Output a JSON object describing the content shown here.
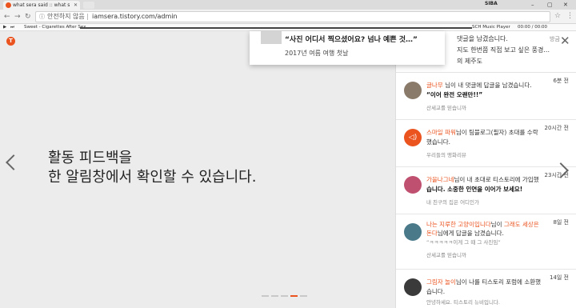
{
  "browser": {
    "tab_title": "what sera said :: what s",
    "user_label": "SIBA",
    "security_label": "안전하지 않음",
    "url": "iamsera.tistory.com/admin"
  },
  "mediabar": {
    "track_title": "Sweet - Cigarettes After Sex",
    "player_name": "SCH Music Player",
    "time": "00:00 / 00:00"
  },
  "page": {
    "logo_letter": "T",
    "headline_line1": "활동 피드백을",
    "headline_line2": "한 알림창에서 확인할 수 있습니다.",
    "pager_count": 5,
    "pager_active_index": 4
  },
  "card": {
    "title": "“사진 어디서 찍으셨어요? 넘나 예쁜 것…”",
    "subtitle": "2017년 여름 여행 첫날"
  },
  "panel": {
    "top_line1": "댓글을 남겼습니다.",
    "top_line2": "지도 한번쯤 직접 보고 싶은 풍경...",
    "top_line3": "의 제주도",
    "top_tag": "방금",
    "notifications": [
      {
        "name": "글나무",
        "text": " 님이 내 댓글에 답글을 남겼습니다.",
        "bold": "“이어 완전 오랜만!!”",
        "sub": "산세교를 믿습니까",
        "time": "6분 전"
      },
      {
        "name": "스마일 파워",
        "text": "님이 팀블로그(필자) 초대를 수락",
        "text2": "했습니다.",
        "sub": "우리들의 맹화리뷰",
        "time": "20시간 전"
      },
      {
        "name": "가을나그네",
        "text": "님이 내 초대로 티스토리에 가입했",
        "bold": "습니다. 소중한 인연을 이어가 보세요!",
        "sub": "내 친구의 집은 어디인가",
        "time": "23시간 전"
      },
      {
        "name": "나는 지루한 고양이입니다",
        "text": "님이 ",
        "name2": "그래도 세상은",
        "name3": "돈다",
        "text2": "님에게 답글을 남겼습니다.",
        "small": "“ㅋㅋㅋㅋㅋ이게 그 때 그 사진임”",
        "sub": "산세교를 믿습니까",
        "time": "8일 전"
      },
      {
        "name": "그림자 놀이",
        "text": "님이 나를 티스토리 포럼에 소환했",
        "text2": "습니다.",
        "sub": "안녕하세요. 티스토리 뉴비입니다.",
        "time": "14일 전"
      }
    ]
  },
  "colors": {
    "accent": "#eb531f"
  },
  "icons": [
    "favicon-icon",
    "close-icon",
    "back-icon",
    "forward-icon",
    "reload-icon",
    "info-icon",
    "star-icon",
    "menu-icon",
    "play-icon",
    "chevron-left-icon",
    "chevron-right-icon",
    "notification-sound-icon"
  ]
}
